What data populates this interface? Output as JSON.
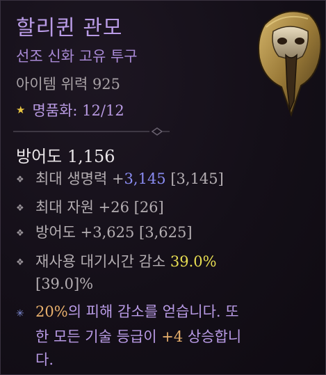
{
  "item": {
    "name": "할리퀸 관모",
    "rarity": "선조 신화 고유 투구",
    "power": "아이템 위력 925",
    "masterwork_label": "명품화: 12/12"
  },
  "armor": "방어도 1,156",
  "stats": [
    {
      "pre": "최대 생명력 +",
      "highlight": "3,145",
      "post": " [3,145]"
    },
    {
      "pre": "최대 자원 +26 [26]",
      "highlight": "",
      "post": ""
    },
    {
      "pre": "방어도 +3,625 [3,625]",
      "highlight": "",
      "post": ""
    },
    {
      "pre": "재사용 대기시간 감소 ",
      "highlight": "39.0%",
      "post": "",
      "line2": "[39.0]%"
    }
  ],
  "aspect": {
    "value": "20%",
    "line1_rest": "의 피해 감소를 얻습니다. 또",
    "line2_pre": "한 모든 기술 등급이 ",
    "line2_value": "+4",
    "line2_post": " 상승합니",
    "line3": "다."
  },
  "colors": {
    "title": "#b99be6",
    "blue_value": "#8a8cf2",
    "yellow_value": "#e8de52",
    "aspect_value": "#e9b06d"
  },
  "icons": [
    "star-icon",
    "stat-bullet-icon",
    "unique-aspect-icon",
    "harlequin-crest-helm-image"
  ]
}
